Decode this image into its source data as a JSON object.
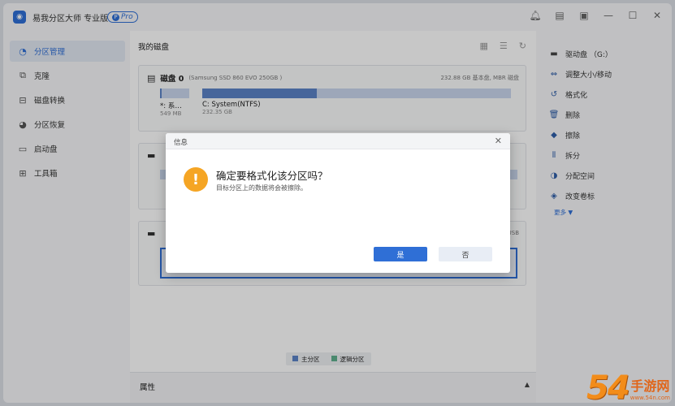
{
  "app": {
    "title": "易我分区大师 专业版",
    "badge": "Pro"
  },
  "window_controls": [
    "bell-icon",
    "note-icon",
    "settings-icon",
    "minimize-icon",
    "maximize-icon",
    "close-icon"
  ],
  "sidebar": {
    "items": [
      {
        "label": "分区管理",
        "icon": "pie-icon",
        "active": true
      },
      {
        "label": "克隆",
        "icon": "clone-icon"
      },
      {
        "label": "磁盘转换",
        "icon": "disk-convert-icon"
      },
      {
        "label": "分区恢复",
        "icon": "recover-icon"
      },
      {
        "label": "启动盘",
        "icon": "boot-disk-icon"
      },
      {
        "label": "工具箱",
        "icon": "toolbox-icon"
      }
    ]
  },
  "main": {
    "title": "我的磁盘",
    "disk0": {
      "label": "磁盘 0",
      "model": "(Samsung SSD 860 EVO 250GB )",
      "info": "232.88 GB 基本盘, MBR 磁盘",
      "partitions": [
        {
          "name": "*: 系…",
          "size": "549 MB",
          "used_fraction": 0.05
        },
        {
          "name": "C: System(NTFS)",
          "size": "232.35 GB",
          "used_fraction": 0.37
        }
      ]
    },
    "disk3_info": "USB",
    "legend": {
      "primary": "主分区",
      "logical": "逻辑分区"
    },
    "properties_label": "属性"
  },
  "right_panel": {
    "header": "驱动盘 （G:）",
    "actions": [
      {
        "label": "调整大小/移动",
        "icon": "resize-icon"
      },
      {
        "label": "格式化",
        "icon": "format-icon"
      },
      {
        "label": "删除",
        "icon": "trash-icon"
      },
      {
        "label": "擦除",
        "icon": "eraser-icon"
      },
      {
        "label": "拆分",
        "icon": "split-icon"
      },
      {
        "label": "分配空间",
        "icon": "allocate-icon"
      },
      {
        "label": "改变卷标",
        "icon": "tag-icon"
      }
    ],
    "more": "更多 ▼"
  },
  "dialog": {
    "title": "信息",
    "question": "确定要格式化该分区吗？",
    "message": "目标分区上的数据将会被擦除。",
    "yes": "是",
    "no": "否"
  },
  "watermark": {
    "number": "54",
    "text": "手游网",
    "url": "www.54n.com"
  },
  "colors": {
    "accent": "#2f6fd6",
    "primary_partition": "#5b83c7",
    "logical_partition": "#5fb08e",
    "warning": "#f5a524"
  }
}
